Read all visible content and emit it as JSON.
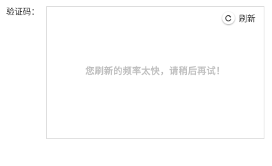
{
  "form": {
    "captcha_label": "验证码："
  },
  "captcha": {
    "refresh_icon": "refresh-icon",
    "refresh_label": "刷新",
    "message": "您刷新的频率太快，请稍后再试！"
  },
  "colors": {
    "border": "#dcdcdc",
    "message": "#c0c0c0",
    "text": "#333333"
  }
}
